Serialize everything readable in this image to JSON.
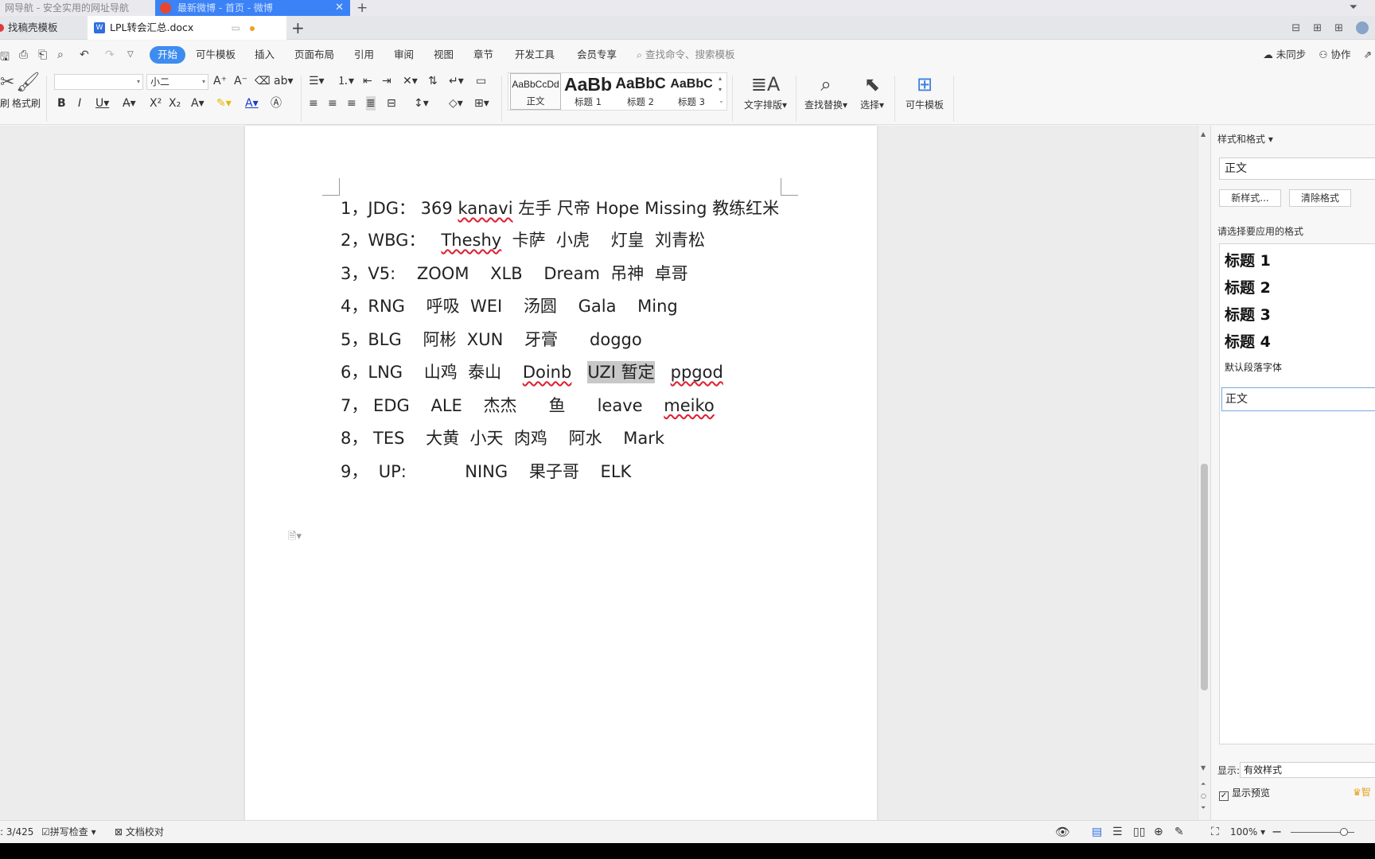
{
  "browser": {
    "tabs": [
      {
        "label": "网导航 - 安全实用的网址导航"
      },
      {
        "label": "最新微博 - 首页 - 微博"
      }
    ]
  },
  "doc_tabs": [
    {
      "label": "找稿壳模板"
    },
    {
      "label": "LPL转会汇总.docx"
    }
  ],
  "menu": {
    "items": [
      "开始",
      "可牛模板",
      "插入",
      "页面布局",
      "引用",
      "审阅",
      "视图",
      "章节",
      "开发工具",
      "会员专享"
    ],
    "search_placeholder": "查找命令、搜索模板",
    "sync": "未同步",
    "collab": "协作"
  },
  "ribbon": {
    "format_painter": "格式刷",
    "font_name": "",
    "font_size": "小二",
    "styles": [
      {
        "preview": "AaBbCcDd",
        "name": "正文"
      },
      {
        "preview": "AaBb",
        "name": "标题 1"
      },
      {
        "preview": "AaBbC",
        "name": "标题 2"
      },
      {
        "preview": "AaBbC",
        "name": "标题 3"
      }
    ],
    "text_layout": "文字排版",
    "find_replace": "查找替换",
    "select": "选择",
    "keniu_template": "可牛模板"
  },
  "document": {
    "lines": [
      {
        "num": "1，",
        "text_parts": [
          "JDG：  369   ",
          {
            "sq": "kanavi"
          },
          "   左手  尺帝  Hope   Missing  教练红米"
        ]
      },
      {
        "num": "2，",
        "text_parts": [
          "WBG：   ",
          {
            "sq": "Theshy"
          },
          "  卡萨  小虎    灯皇  刘青松"
        ]
      },
      {
        "num": "3，",
        "text_parts": [
          "V5:    ZOOM    XLB    Dream  吊神  卓哥"
        ]
      },
      {
        "num": "4，",
        "text_parts": [
          "RNG    呼吸  WEI    汤圆    Gala    Ming"
        ]
      },
      {
        "num": "5，",
        "text_parts": [
          "BLG    阿彬  XUN    牙膏      doggo"
        ]
      },
      {
        "num": "6，",
        "text_parts": [
          "LNG    山鸡  泰山    ",
          {
            "sq": "Doinb"
          },
          "   ",
          {
            "hl": "UZI 暂定"
          },
          "   ",
          {
            "sq": "ppgod"
          }
        ]
      },
      {
        "num": "7，",
        "text_parts": [
          " EDG    ALE    杰杰      鱼      leave    ",
          {
            "sq": "meiko"
          }
        ]
      },
      {
        "num": "8，",
        "text_parts": [
          " TES    大黄  小天  肉鸡    阿水    Mark"
        ]
      },
      {
        "num": "9，",
        "text_parts": [
          "  UP:           NING    果子哥    ELK"
        ]
      }
    ]
  },
  "side_panel": {
    "title": "样式和格式",
    "current_style": "正文",
    "new_style": "新样式...",
    "clear_format": "清除格式",
    "prompt": "请选择要应用的格式",
    "headings": [
      "标题  1",
      "标题  2",
      "标题  3",
      "标题  4"
    ],
    "default_font": "默认段落字体",
    "selected": "正文",
    "show_label": "显示:",
    "show_value": "有效样式",
    "preview_label": "显示预览",
    "smart": "智"
  },
  "status": {
    "page": ": 3/425",
    "spell": "拼写检查",
    "proof": "文档校对",
    "zoom": "100%"
  }
}
